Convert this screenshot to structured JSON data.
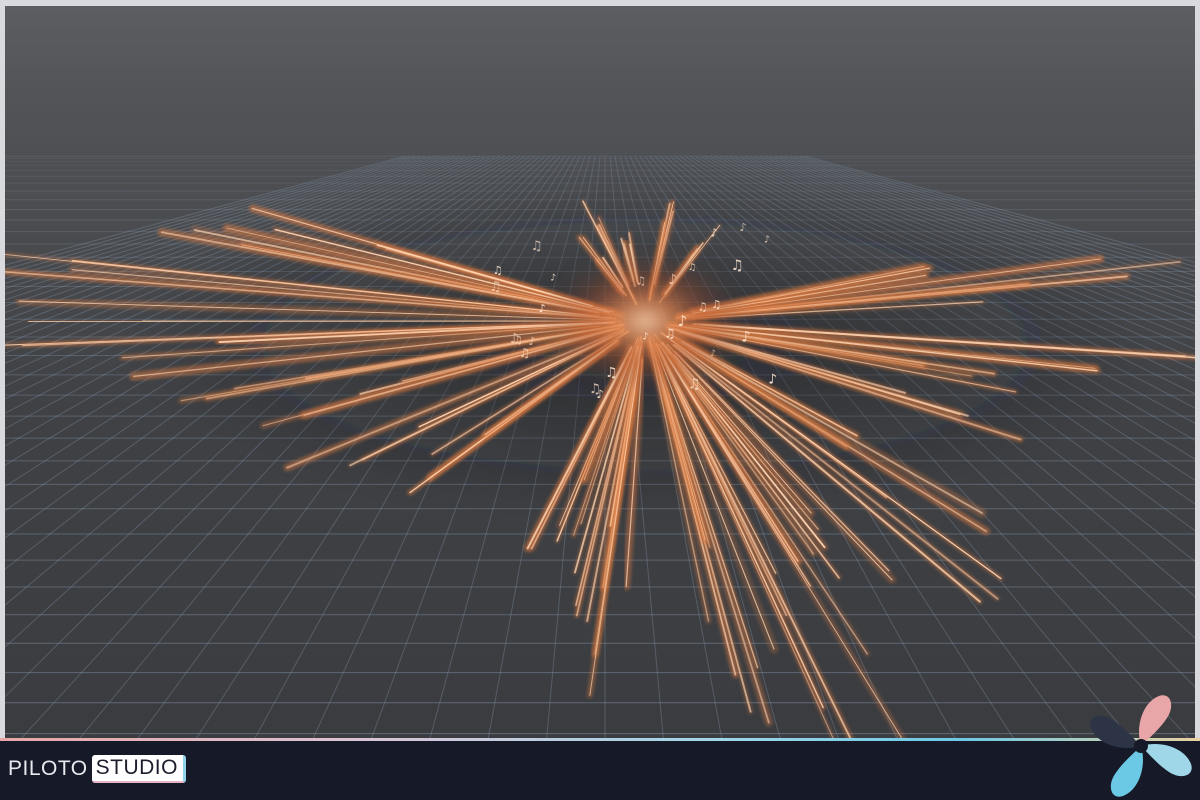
{
  "footer": {
    "brand_left": "PILOTO",
    "brand_right": "STUDIO"
  },
  "viewport": {
    "scene": "vfx-burst-preview",
    "grid_color": "#8fa2b8",
    "burst_core_color": "#e07b3f",
    "streak_color": "#ffd9b8"
  },
  "logo": {
    "icon": "fan-logo-icon",
    "colors": [
      "#e9a6a8",
      "#9fd6e8",
      "#e9d2a0",
      "#6cc9e6"
    ]
  }
}
